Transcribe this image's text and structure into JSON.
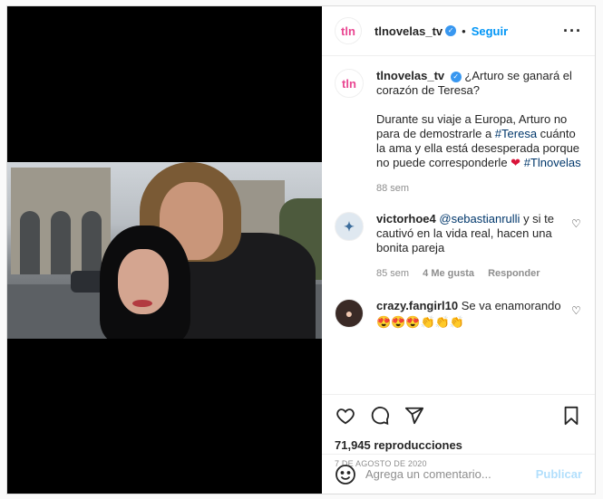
{
  "account": {
    "initials": "tln",
    "username": "tlnovelas_tv",
    "follow_label": "Seguir",
    "separator": "•"
  },
  "caption": {
    "username": "tlnovelas_tv",
    "line1": "¿Arturo se ganará el corazón de Teresa?",
    "body_a": "Durante su viaje a Europa, Arturo no para de demostrarle a ",
    "hashtag1": "#Teresa",
    "body_b": " cuánto la ama y ella está desesperada porque no puede corresponderle ",
    "heart": "❤",
    "hashtag2": "#Tlnovelas",
    "time": "88 sem"
  },
  "comments": [
    {
      "username": "victorhoe4",
      "mention": "@sebastianrulli",
      "text": " y si te cautivó en la vida real, hacen una bonita pareja",
      "time": "85 sem",
      "likes": "4 Me gusta",
      "reply": "Responder",
      "avatar": "✦"
    },
    {
      "username": "crazy.fangirl10",
      "text": "Se va enamorando",
      "emojis": "😍😍😍👏👏👏",
      "avatar": "●"
    }
  ],
  "stats": {
    "views": "71,945 reproducciones",
    "date": "7 de agosto de 2020"
  },
  "composer": {
    "placeholder": "Agrega un comentario...",
    "publish_label": "Publicar"
  },
  "icons": [
    "more-options-icon",
    "heart-icon",
    "comment-icon",
    "share-icon",
    "bookmark-icon",
    "emoji-icon",
    "verified-badge-icon"
  ],
  "colors": {
    "link": "#0095f6",
    "brand": "#e94691",
    "verified": "#3897f0",
    "muted": "#8e8e8e",
    "publish_disabled": "#b2dffc"
  }
}
